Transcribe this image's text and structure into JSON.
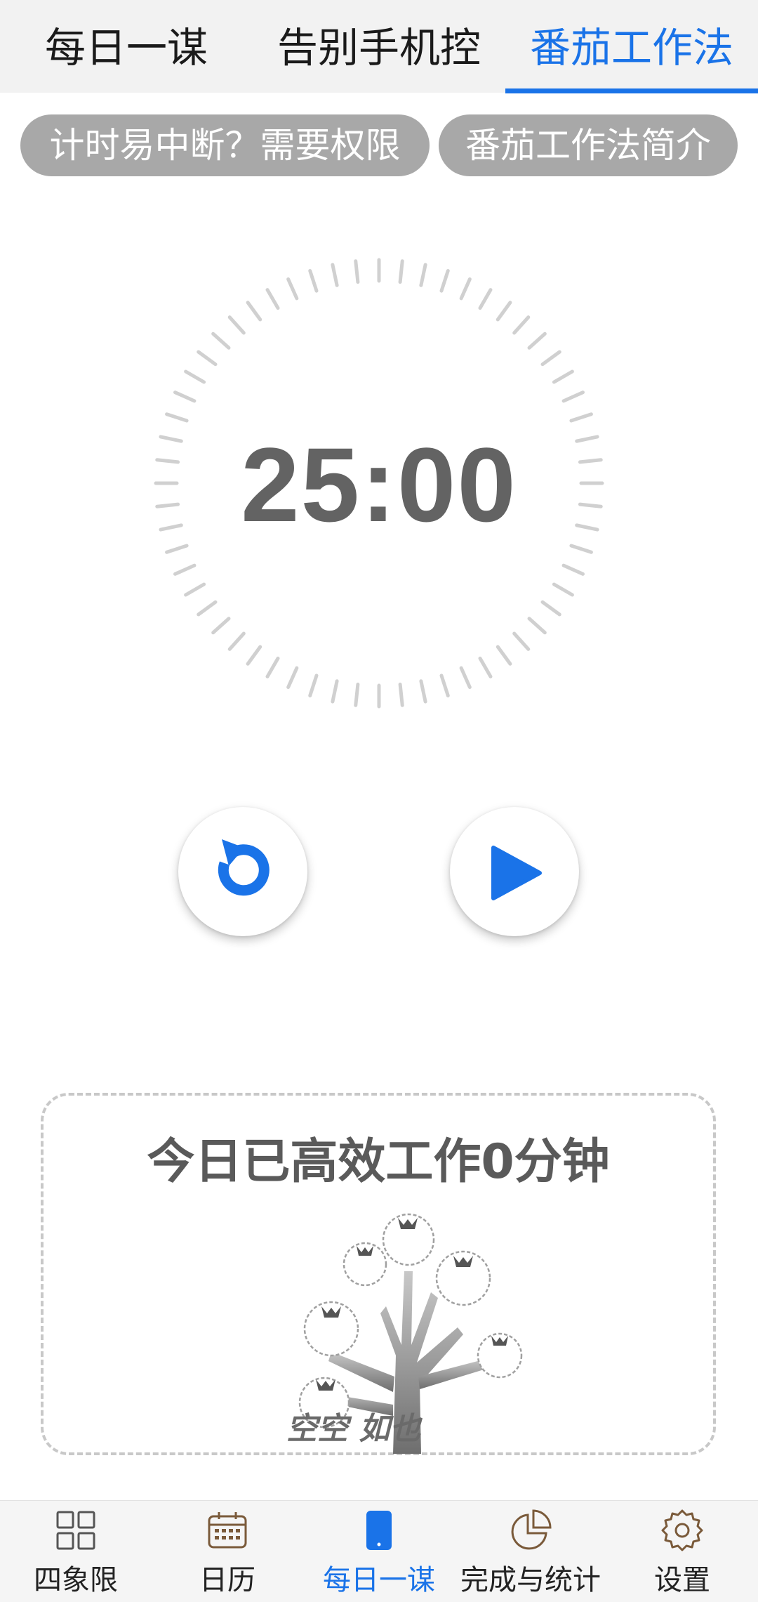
{
  "top_tabs": [
    {
      "label": "每日一谋",
      "active": false
    },
    {
      "label": "告别手机控",
      "active": false
    },
    {
      "label": "番茄工作法",
      "active": true
    }
  ],
  "chips": [
    {
      "label": "计时易中断？需要权限"
    },
    {
      "label": "番茄工作法简介"
    }
  ],
  "timer": {
    "display": "25:00"
  },
  "controls": {
    "reset_icon": "reset-icon",
    "play_icon": "play-icon"
  },
  "stats": {
    "title": "今日已高效工作0分钟",
    "caption": "空空 如也"
  },
  "bottom_nav": [
    {
      "label": "四象限",
      "icon": "grid-icon",
      "active": false
    },
    {
      "label": "日历",
      "icon": "calendar-icon",
      "active": false
    },
    {
      "label": "每日一谋",
      "icon": "phone-icon",
      "active": true
    },
    {
      "label": "完成与统计",
      "icon": "pie-chart-icon",
      "active": false
    },
    {
      "label": "设置",
      "icon": "gear-icon",
      "active": false
    }
  ],
  "colors": {
    "accent": "#1a73e8",
    "chip_bg": "#a8a8a8",
    "timer_text": "#636363",
    "tick": "#d0d0d0"
  }
}
